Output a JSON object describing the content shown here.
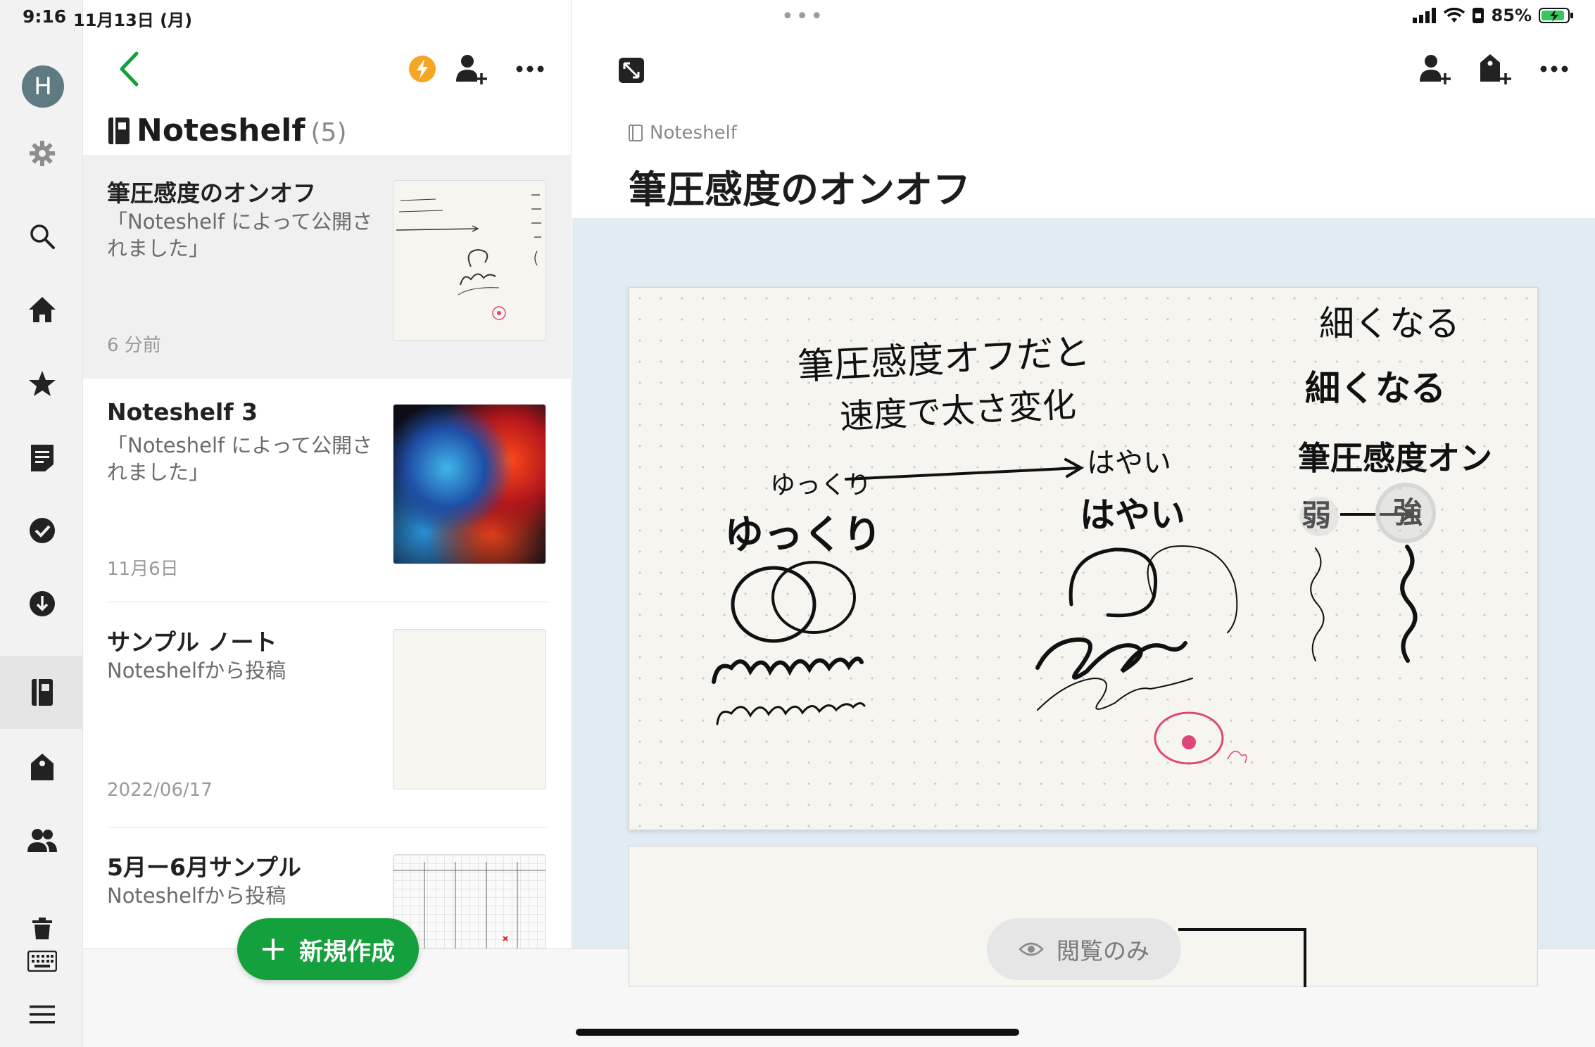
{
  "status": {
    "time": "9:16",
    "date": "11月13日 (月)",
    "battery": "85%"
  },
  "rail": {
    "avatar_letter": "H"
  },
  "list": {
    "notebook_name": "Noteshelf",
    "notebook_count": "(5)",
    "notes": [
      {
        "title": "筆圧感度のオンオフ",
        "snippet": "「Noteshelf によって公開されました」",
        "date": "6 分前"
      },
      {
        "title": "Noteshelf 3",
        "snippet": "「Noteshelf によって公開されました」",
        "date": "11月6日"
      },
      {
        "title": "サンプル ノート",
        "snippet": "Noteshelfから投稿",
        "date": "2022/06/17"
      },
      {
        "title": "5月ー6月サンプル",
        "snippet": "Noteshelfから投稿",
        "date": ""
      }
    ],
    "new_button": "新規作成"
  },
  "detail": {
    "breadcrumb": "Noteshelf",
    "title": "筆圧感度のオンオフ",
    "readonly_label": "閲覧のみ",
    "handwriting": {
      "line1": "筆圧感度オフだと",
      "line2": "速度で太さ変化",
      "slow": "ゆっくり",
      "fast": "はやい",
      "slow2": "ゆっくり",
      "fast2": "はやい",
      "thin1": "細くなる",
      "thin2": "細くなる",
      "pressure_on": "筆圧感度オン",
      "weak": "弱",
      "strong": "強"
    }
  },
  "colors": {
    "accent_green": "#14a03c",
    "canvas_bg": "#e0ecf1",
    "lightning": "#f5a623"
  }
}
